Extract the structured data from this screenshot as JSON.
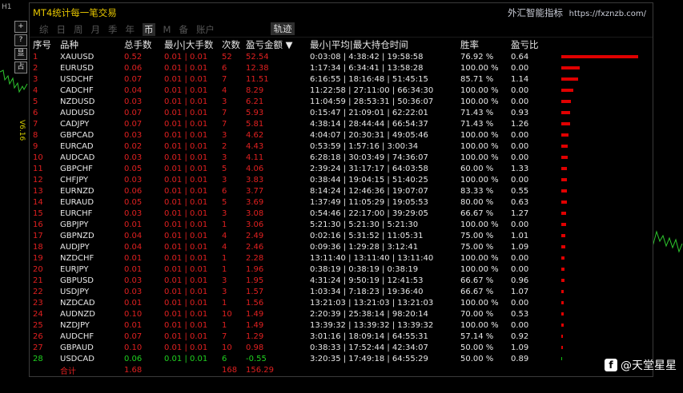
{
  "top_corner": "H1",
  "ea_label": "V6.16",
  "side_tools": [
    "+",
    "?",
    "显",
    "占"
  ],
  "app_title": "MT4统计每一笔交易",
  "brand": {
    "name": "外汇智能指标",
    "url": "https://fxznzb.com/"
  },
  "tabs": [
    "综",
    "日",
    "周",
    "月",
    "季",
    "年",
    "币",
    "M",
    "备",
    "账户"
  ],
  "active_tab": 6,
  "track_button": "轨迹",
  "headers": [
    "序号",
    "品种",
    "总手数",
    "最小|大手数",
    "次数",
    "盈亏金额 ▼",
    "最小|平均|最大持仓时间",
    "胜率",
    "盈亏比",
    ""
  ],
  "rows": [
    {
      "idx": "1",
      "sym": "XAUUSD",
      "lots": "0.52",
      "mm": "0.01 | 0.01",
      "cnt": "52",
      "pl": "52.54",
      "time": "0:03:08 | 4:38:42 | 19:58:58",
      "rate": "76.92 %",
      "ratio": "0.64",
      "bar": 1.0
    },
    {
      "idx": "2",
      "sym": "EURUSD",
      "lots": "0.06",
      "mm": "0.01 | 0.01",
      "cnt": "6",
      "pl": "12.38",
      "time": "1:17:34 | 6:34:41 | 13:58:28",
      "rate": "100.00 %",
      "ratio": "0.00",
      "bar": 0.24
    },
    {
      "idx": "3",
      "sym": "USDCHF",
      "lots": "0.07",
      "mm": "0.01 | 0.01",
      "cnt": "7",
      "pl": "11.51",
      "time": "6:16:55 | 18:16:48 | 51:45:15",
      "rate": "85.71 %",
      "ratio": "1.14",
      "bar": 0.22
    },
    {
      "idx": "4",
      "sym": "CADCHF",
      "lots": "0.04",
      "mm": "0.01 | 0.01",
      "cnt": "4",
      "pl": "8.29",
      "time": "11:22:58 | 27:11:00 | 66:34:30",
      "rate": "100.00 %",
      "ratio": "0.00",
      "bar": 0.16
    },
    {
      "idx": "5",
      "sym": "NZDUSD",
      "lots": "0.03",
      "mm": "0.01 | 0.01",
      "cnt": "3",
      "pl": "6.21",
      "time": "11:04:59 | 28:53:31 | 50:36:07",
      "rate": "100.00 %",
      "ratio": "0.00",
      "bar": 0.12
    },
    {
      "idx": "6",
      "sym": "AUDUSD",
      "lots": "0.07",
      "mm": "0.01 | 0.01",
      "cnt": "7",
      "pl": "5.93",
      "time": "0:15:47 | 21:09:01 | 62:22:01",
      "rate": "71.43 %",
      "ratio": "0.93",
      "bar": 0.11
    },
    {
      "idx": "7",
      "sym": "CADJPY",
      "lots": "0.07",
      "mm": "0.01 | 0.01",
      "cnt": "7",
      "pl": "5.81",
      "time": "4:38:14 | 28:44:44 | 66:54:37",
      "rate": "71.43 %",
      "ratio": "1.26",
      "bar": 0.11
    },
    {
      "idx": "8",
      "sym": "GBPCAD",
      "lots": "0.03",
      "mm": "0.01 | 0.01",
      "cnt": "3",
      "pl": "4.62",
      "time": "4:04:07 | 20:30:31 | 49:05:46",
      "rate": "100.00 %",
      "ratio": "0.00",
      "bar": 0.09
    },
    {
      "idx": "9",
      "sym": "EURCAD",
      "lots": "0.02",
      "mm": "0.01 | 0.01",
      "cnt": "2",
      "pl": "4.43",
      "time": "0:53:59 | 1:57:16 | 3:00:34",
      "rate": "100.00 %",
      "ratio": "0.00",
      "bar": 0.085
    },
    {
      "idx": "10",
      "sym": "AUDCAD",
      "lots": "0.03",
      "mm": "0.01 | 0.01",
      "cnt": "3",
      "pl": "4.11",
      "time": "6:28:18 | 30:03:49 | 74:36:07",
      "rate": "100.00 %",
      "ratio": "0.00",
      "bar": 0.08
    },
    {
      "idx": "11",
      "sym": "GBPCHF",
      "lots": "0.05",
      "mm": "0.01 | 0.01",
      "cnt": "5",
      "pl": "4.06",
      "time": "2:39:24 | 31:17:17 | 64:03:58",
      "rate": "60.00 %",
      "ratio": "1.33",
      "bar": 0.078
    },
    {
      "idx": "12",
      "sym": "CHFJPY",
      "lots": "0.03",
      "mm": "0.01 | 0.01",
      "cnt": "3",
      "pl": "3.83",
      "time": "0:38:44 | 19:04:15 | 51:40:25",
      "rate": "100.00 %",
      "ratio": "0.00",
      "bar": 0.073
    },
    {
      "idx": "13",
      "sym": "EURNZD",
      "lots": "0.06",
      "mm": "0.01 | 0.01",
      "cnt": "6",
      "pl": "3.77",
      "time": "8:14:24 | 12:46:36 | 19:07:07",
      "rate": "83.33 %",
      "ratio": "0.55",
      "bar": 0.072
    },
    {
      "idx": "14",
      "sym": "EURAUD",
      "lots": "0.05",
      "mm": "0.01 | 0.01",
      "cnt": "5",
      "pl": "3.69",
      "time": "1:37:49 | 11:05:29 | 19:05:53",
      "rate": "80.00 %",
      "ratio": "0.63",
      "bar": 0.07
    },
    {
      "idx": "15",
      "sym": "EURCHF",
      "lots": "0.03",
      "mm": "0.01 | 0.01",
      "cnt": "3",
      "pl": "3.08",
      "time": "0:54:46 | 22:17:00 | 39:29:05",
      "rate": "66.67 %",
      "ratio": "1.27",
      "bar": 0.059
    },
    {
      "idx": "16",
      "sym": "GBPJPY",
      "lots": "0.01",
      "mm": "0.01 | 0.01",
      "cnt": "1",
      "pl": "3.06",
      "time": "5:21:30 | 5:21:30 | 5:21:30",
      "rate": "100.00 %",
      "ratio": "0.00",
      "bar": 0.058
    },
    {
      "idx": "17",
      "sym": "GBPNZD",
      "lots": "0.04",
      "mm": "0.01 | 0.01",
      "cnt": "4",
      "pl": "2.49",
      "time": "0:02:16 | 5:31:52 | 11:05:31",
      "rate": "75.00 %",
      "ratio": "1.01",
      "bar": 0.047
    },
    {
      "idx": "18",
      "sym": "AUDJPY",
      "lots": "0.04",
      "mm": "0.01 | 0.01",
      "cnt": "4",
      "pl": "2.46",
      "time": "0:09:36 | 1:29:28 | 3:12:41",
      "rate": "75.00 %",
      "ratio": "1.09",
      "bar": 0.047
    },
    {
      "idx": "19",
      "sym": "NZDCHF",
      "lots": "0.01",
      "mm": "0.01 | 0.01",
      "cnt": "1",
      "pl": "2.28",
      "time": "13:11:40 | 13:11:40 | 13:11:40",
      "rate": "100.00 %",
      "ratio": "0.00",
      "bar": 0.043
    },
    {
      "idx": "20",
      "sym": "EURJPY",
      "lots": "0.01",
      "mm": "0.01 | 0.01",
      "cnt": "1",
      "pl": "1.96",
      "time": "0:38:19 | 0:38:19 | 0:38:19",
      "rate": "100.00 %",
      "ratio": "0.00",
      "bar": 0.037
    },
    {
      "idx": "21",
      "sym": "GBPUSD",
      "lots": "0.03",
      "mm": "0.01 | 0.01",
      "cnt": "3",
      "pl": "1.95",
      "time": "4:31:24 | 9:50:19 | 12:41:53",
      "rate": "66.67 %",
      "ratio": "0.96",
      "bar": 0.037
    },
    {
      "idx": "22",
      "sym": "USDJPY",
      "lots": "0.03",
      "mm": "0.01 | 0.01",
      "cnt": "3",
      "pl": "1.57",
      "time": "1:03:34 | 7:18:23 | 19:36:40",
      "rate": "66.67 %",
      "ratio": "1.07",
      "bar": 0.03
    },
    {
      "idx": "23",
      "sym": "NZDCAD",
      "lots": "0.01",
      "mm": "0.01 | 0.01",
      "cnt": "1",
      "pl": "1.56",
      "time": "13:21:03 | 13:21:03 | 13:21:03",
      "rate": "100.00 %",
      "ratio": "0.00",
      "bar": 0.03
    },
    {
      "idx": "24",
      "sym": "AUDNZD",
      "lots": "0.10",
      "mm": "0.01 | 0.01",
      "cnt": "10",
      "pl": "1.49",
      "time": "2:20:39 | 25:38:14 | 98:20:14",
      "rate": "70.00 %",
      "ratio": "0.53",
      "bar": 0.028
    },
    {
      "idx": "25",
      "sym": "NZDJPY",
      "lots": "0.01",
      "mm": "0.01 | 0.01",
      "cnt": "1",
      "pl": "1.49",
      "time": "13:39:32 | 13:39:32 | 13:39:32",
      "rate": "100.00 %",
      "ratio": "0.00",
      "bar": 0.028
    },
    {
      "idx": "26",
      "sym": "AUDCHF",
      "lots": "0.07",
      "mm": "0.01 | 0.01",
      "cnt": "7",
      "pl": "1.29",
      "time": "3:01:16 | 18:09:14 | 64:55:31",
      "rate": "57.14 %",
      "ratio": "0.92",
      "bar": 0.025
    },
    {
      "idx": "27",
      "sym": "GBPAUD",
      "lots": "0.10",
      "mm": "0.01 | 0.01",
      "cnt": "10",
      "pl": "0.98",
      "time": "0:38:33 | 17:52:44 | 42:34:07",
      "rate": "50.00 %",
      "ratio": "1.09",
      "bar": 0.019
    },
    {
      "idx": "28",
      "sym": "USDCAD",
      "lots": "0.06",
      "mm": "0.01 | 0.01",
      "cnt": "6",
      "pl": "-0.55",
      "time": "3:20:35 | 17:49:18 | 64:55:29",
      "rate": "50.00 %",
      "ratio": "0.89",
      "bar": 0.011,
      "positive": false
    }
  ],
  "total": {
    "label": "合计",
    "lots": "1.68",
    "cnt": "168",
    "pl": "156.29"
  },
  "watermark": "@天堂星星",
  "colors": {
    "positive": "#e02020",
    "negative": "#20d020",
    "title": "#e6c600"
  }
}
